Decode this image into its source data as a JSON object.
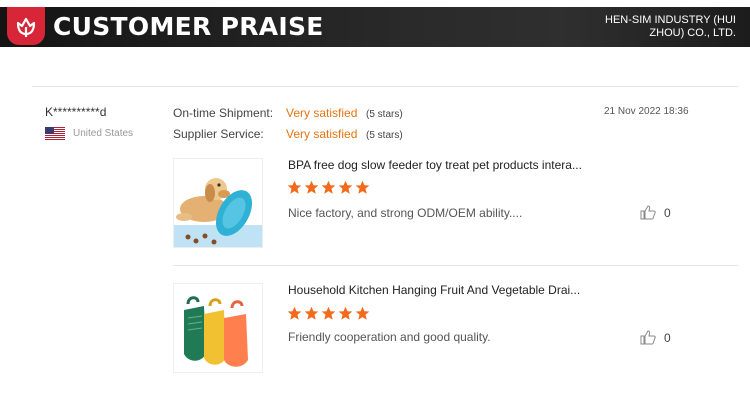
{
  "banner": {
    "title": "CUSTOMER PRAISE",
    "company": "HEN-SIM INDUSTRY (HUI ZHOU) CO., LTD.",
    "icon": "tulip-icon",
    "accent_color": "#d72638"
  },
  "review": {
    "reviewer": "K**********d",
    "country": "United States",
    "flag_icon": "us-flag-icon",
    "date": "21 Nov 2022 18:36",
    "ratings": [
      {
        "label": "On-time Shipment:",
        "value": "Very satisfied",
        "stars": "(5 stars)"
      },
      {
        "label": "Supplier Service:",
        "value": "Very satisfied",
        "stars": "(5 stars)"
      }
    ],
    "rating_color": "#e8730f"
  },
  "products": [
    {
      "title": "BPA free dog slow feeder toy treat pet products intera...",
      "star_count": 5,
      "comment": "Nice factory, and strong ODM/OEM ability....",
      "likes": "0",
      "image_icon": "dog-toy-image"
    },
    {
      "title": "Household Kitchen Hanging Fruit And Vegetable Drai...",
      "star_count": 5,
      "comment": "Friendly cooperation and good quality.",
      "likes": "0",
      "image_icon": "drain-basket-image"
    }
  ],
  "star_color": "#f26b1d"
}
